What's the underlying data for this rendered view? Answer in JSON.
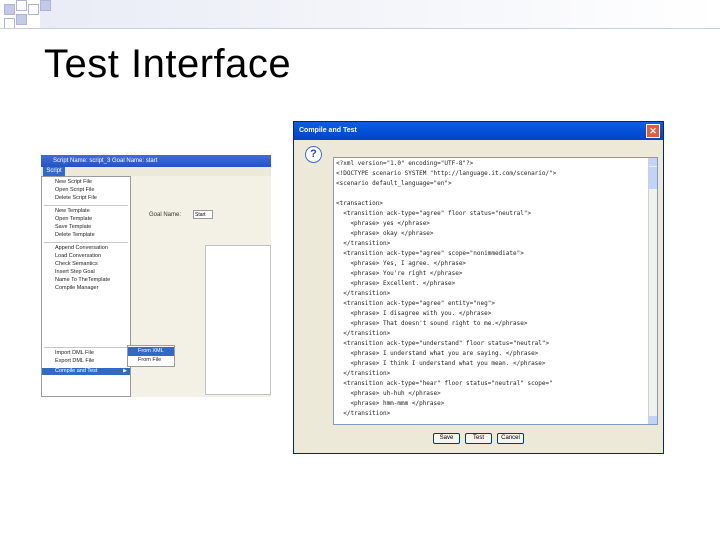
{
  "slide": {
    "title": "Test Interface"
  },
  "menu_screenshot": {
    "titlebar": "Script Name: script_3    Goal Name: start",
    "menu_label": "Script",
    "goal_label": "Goal Name:",
    "goal_value": "Start",
    "items": [
      "New Script File",
      "Open Script File",
      "Delete Script File",
      "New Template",
      "Open Template",
      "Save Template",
      "Delete Template",
      "Append Conversation",
      "Load Conversation",
      "Check Semantics",
      "Insert Step Goal",
      "Name To TheTemplate",
      "Compile Manager",
      "Import DML File",
      "Export DML File",
      "Compile and Test"
    ],
    "submenu": [
      "From XML",
      "From File"
    ]
  },
  "dialog": {
    "title": "Compile and Test",
    "close_glyph": "✕",
    "question_glyph": "?",
    "code_lines": [
      "<?xml version=\"1.0\" encoding=\"UTF-8\"?>",
      "<!DOCTYPE scenario SYSTEM \"http://language.it.com/scenario/\">",
      "<scenario default_language=\"en\">",
      "",
      "<transaction>",
      "  <transition ack-type=\"agree\" floor status=\"neutral\">",
      "    <phrase> yes </phrase>",
      "    <phrase> okay </phrase>",
      "  </transition>",
      "  <transition ack-type=\"agree\" scope=\"nonimmediate\">",
      "    <phrase> Yes, I agree. </phrase>",
      "    <phrase> You're right </phrase>",
      "    <phrase> Excellent. </phrase>",
      "  </transition>",
      "  <transition ack-type=\"agree\" entity=\"neg\">",
      "    <phrase> I disagree with you. </phrase>",
      "    <phrase> That doesn't sound right to me.</phrase>",
      "  </transition>",
      "  <transition ack-type=\"understand\" floor status=\"neutral\">",
      "    <phrase> I understand what you are saying. </phrase>",
      "    <phrase> I think I understand what you mean. </phrase>",
      "  </transition>",
      "  <transition ack-type=\"hear\" floor status=\"neutral\" scope=\"",
      "    <phrase> uh-huh </phrase>",
      "    <phrase> hmm-mmm </phrase>",
      "  </transition>"
    ],
    "buttons": {
      "save": "Save",
      "test": "Test",
      "cancel": "Cancel"
    }
  },
  "colors": {
    "accent": "#316ac5",
    "titlebar": "#0a5ee8",
    "decor": "#c3cae6"
  }
}
